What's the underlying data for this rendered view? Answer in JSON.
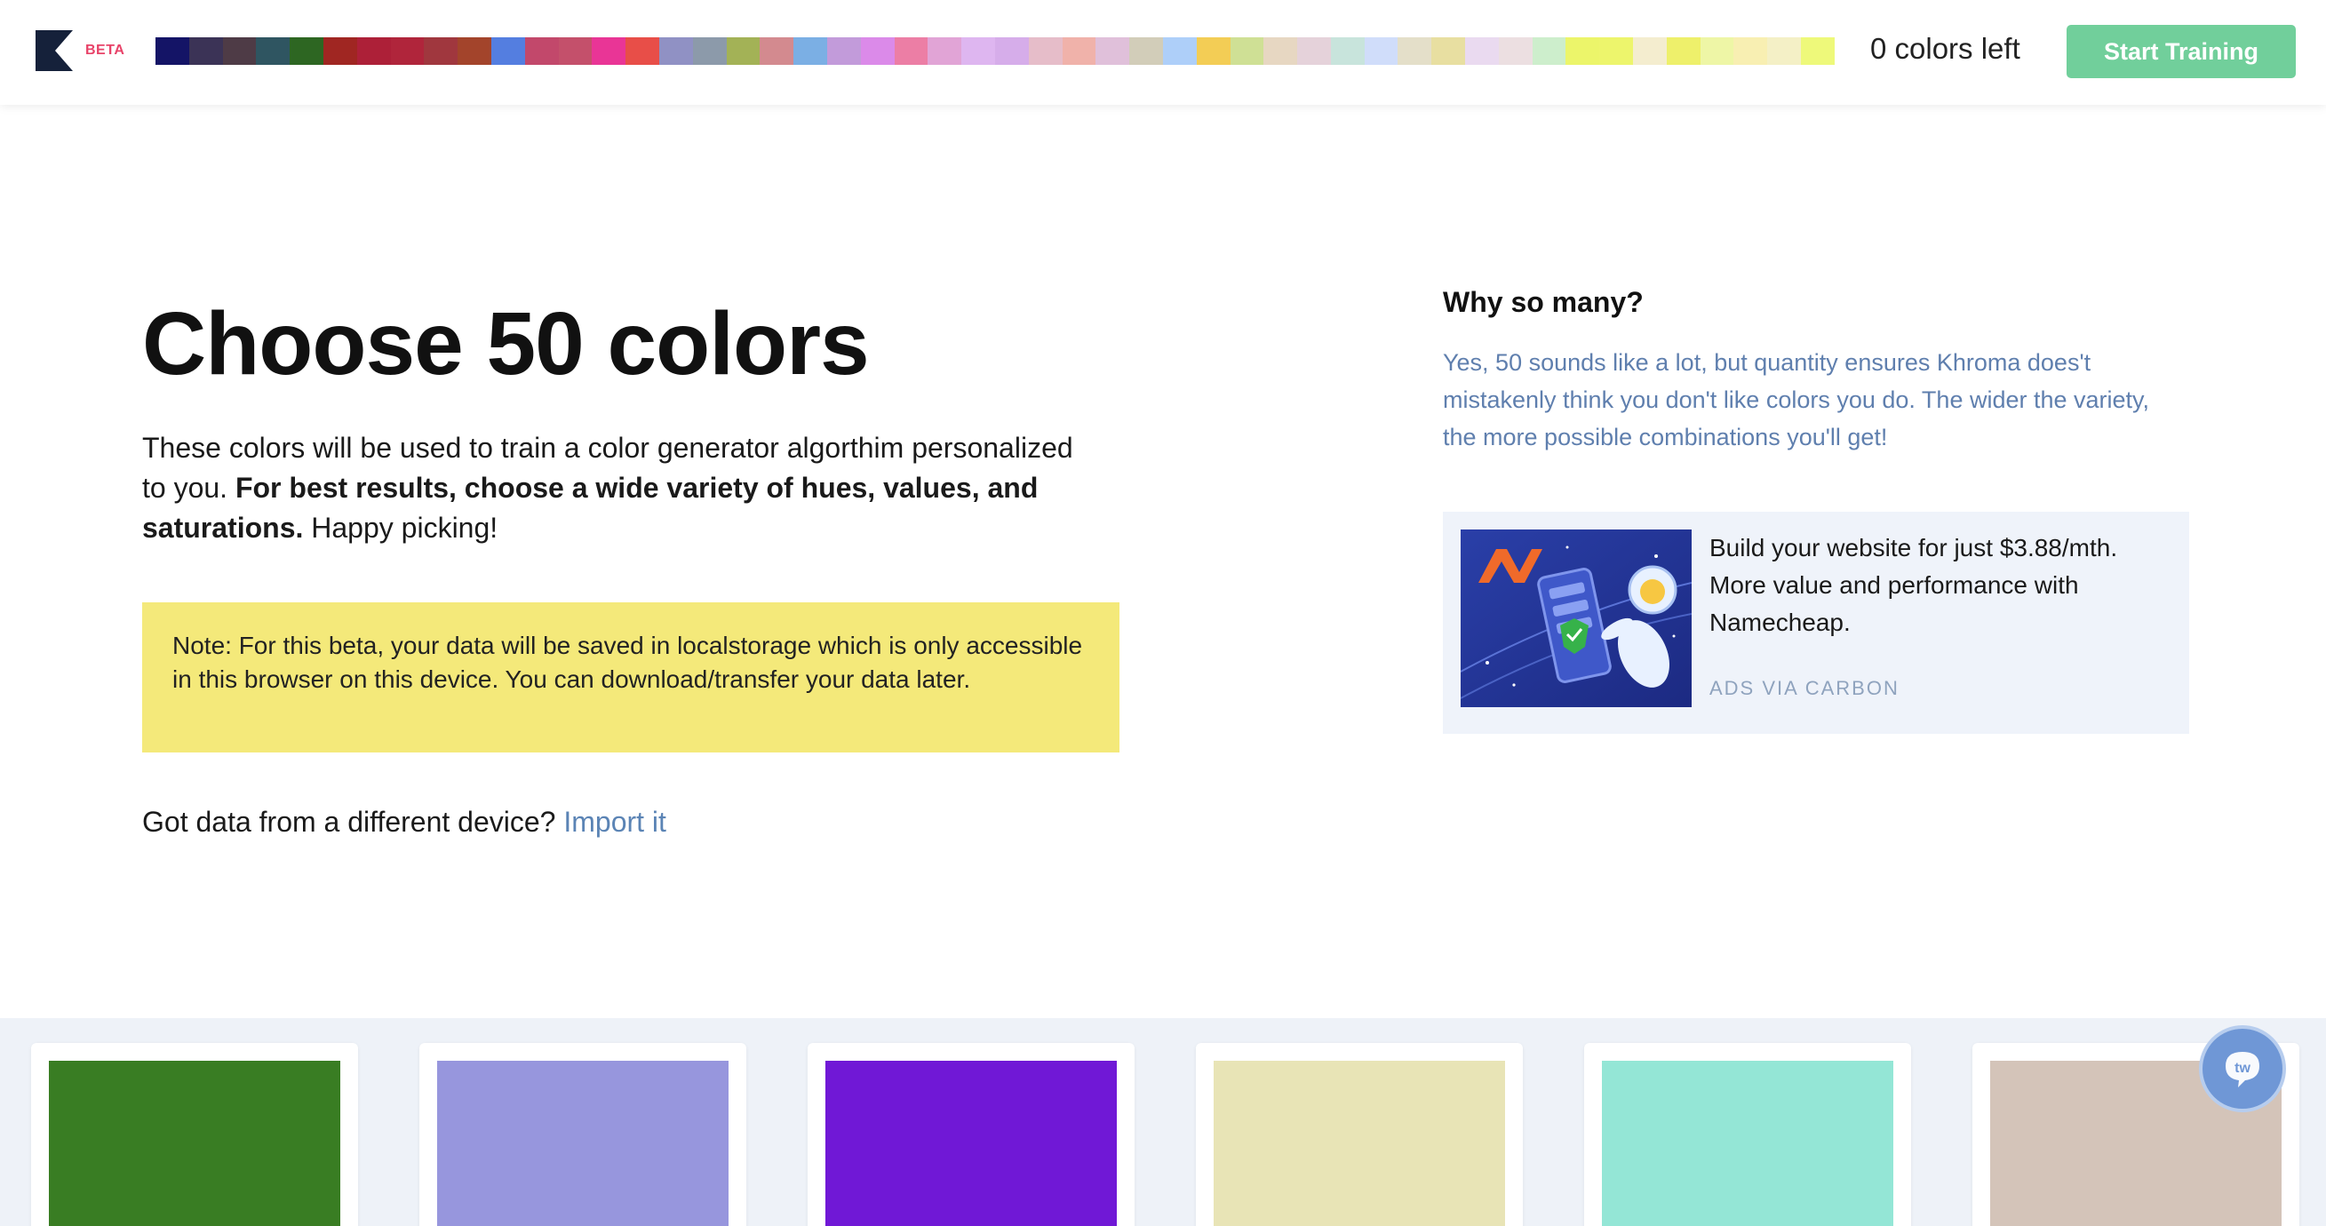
{
  "header": {
    "beta_label": "BETA",
    "palette_label": "selected-colors-palette",
    "palette": [
      "#141466",
      "#3b3356",
      "#4e3b46",
      "#2f5561",
      "#2d6622",
      "#a02622",
      "#ad2038",
      "#b0253b",
      "#a0373e",
      "#a3442b",
      "#547ee0",
      "#c2486b",
      "#c4506b",
      "#e93596",
      "#e84e48",
      "#9091c4",
      "#8c9aaa",
      "#a3b256",
      "#d38a8f",
      "#7bafe4",
      "#c29bda",
      "#db8ae9",
      "#ec7ea5",
      "#e1a4d6",
      "#deb6f0",
      "#d6adea",
      "#e6bdc9",
      "#f0b2aa",
      "#e0c0da",
      "#d2cdb9",
      "#aecff9",
      "#f3cd55",
      "#cfe095",
      "#e7d7c2",
      "#e5d2da",
      "#c8e4dc",
      "#d0ddfa",
      "#e4dfc9",
      "#e8dfa1",
      "#eadaf0",
      "#ecdfe1",
      "#cdeecc",
      "#ecf56a",
      "#edf56c",
      "#f4edcf",
      "#eef06b",
      "#eef6a6",
      "#f8efb2",
      "#f4f0c6",
      "#eef97a"
    ],
    "colors_left": "0 colors left",
    "start_button": "Start Training"
  },
  "main": {
    "headline": "Choose 50 colors",
    "intro_text": "These colors will be used to train a color generator algorthim personalized to you.",
    "intro_bold": "For best results, choose a wide variety of hues, values, and saturations.",
    "intro_end": "Happy picking!",
    "note": "Note: For this beta, your data will be saved in localstorage which is only accessible in this browser on this device. You can download/transfer your data later.",
    "import_prompt": "Got data from a different device?",
    "import_link": "Import it"
  },
  "sidebar": {
    "why_title": "Why so many?",
    "why_body": "Yes, 50 sounds like a lot, but quantity ensures Khroma does't mistakenly think you don't like colors you do. The wider the variety, the more possible combinations you'll get!",
    "ad_text": "Build your website for just $3.88/mth. More value and performance with Namecheap.",
    "ad_via": "ADS VIA CARBON"
  },
  "cards": [
    {
      "color": "#397d23"
    },
    {
      "color": "#9796dd"
    },
    {
      "color": "#7018d6"
    },
    {
      "color": "#e8e4b6"
    },
    {
      "color": "#94e6d6"
    },
    {
      "color": "#d4c4b9"
    }
  ],
  "colors": {
    "brand_accent": "#e84369",
    "button_green": "#71cf9b",
    "note_yellow": "#f4e97a",
    "muted_blue_text": "#5f7fae",
    "link_blue": "#5b84b5"
  },
  "icons": {
    "logo": "khroma-logo-icon",
    "help": "help-chat-icon"
  }
}
